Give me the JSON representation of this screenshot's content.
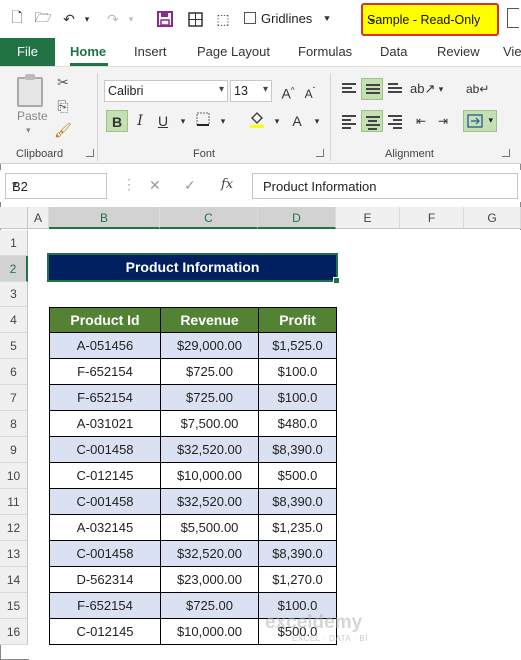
{
  "title_bar": {
    "workbook_label": "Sample  -  Read-Only",
    "gridlines_label": "Gridlines"
  },
  "ribbon_tabs": [
    "File",
    "Home",
    "Insert",
    "Page Layout",
    "Formulas",
    "Data",
    "Review",
    "Vie"
  ],
  "ribbon": {
    "clipboard": {
      "paste_label": "Paste",
      "group_label": "Clipboard"
    },
    "font": {
      "font_name": "Calibri",
      "font_size": "13",
      "group_label": "Font",
      "bold": "B",
      "italic": "I",
      "underline": "U"
    },
    "alignment": {
      "group_label": "Alignment"
    }
  },
  "formula_bar": {
    "name_box": "B2",
    "cancel": "✕",
    "enter": "✓",
    "fx": "fx",
    "content": "Product Information"
  },
  "columns": [
    "A",
    "B",
    "C",
    "D",
    "E",
    "F",
    "G"
  ],
  "rows": [
    "1",
    "2",
    "3",
    "4",
    "5",
    "6",
    "7",
    "8",
    "9",
    "10",
    "11",
    "12",
    "13",
    "14",
    "15",
    "16"
  ],
  "sheet": {
    "title": "Product Information",
    "headers": [
      "Product Id",
      "Revenue",
      "Profit"
    ],
    "data": [
      [
        "A-051456",
        "$29,000.00",
        "$1,525.0"
      ],
      [
        "F-652154",
        "$725.00",
        "$100.0"
      ],
      [
        "F-652154",
        "$725.00",
        "$100.0"
      ],
      [
        "A-031021",
        "$7,500.00",
        "$480.0"
      ],
      [
        "C-001458",
        "$32,520.00",
        "$8,390.0"
      ],
      [
        "C-012145",
        "$10,000.00",
        "$500.0"
      ],
      [
        "C-001458",
        "$32,520.00",
        "$8,390.0"
      ],
      [
        "A-032145",
        "$5,500.00",
        "$1,235.0"
      ],
      [
        "C-001458",
        "$32,520.00",
        "$8,390.0"
      ],
      [
        "D-562314",
        "$23,000.00",
        "$1,270.0"
      ],
      [
        "F-652154",
        "$725.00",
        "$100.0"
      ],
      [
        "C-012145",
        "$10,000.00",
        "$500.0"
      ]
    ]
  },
  "watermark": {
    "name": "exceldemy",
    "tagline": "EXCEL · DATA · BI"
  },
  "colors": {
    "excel_green": "#217346",
    "title_fill": "#002060",
    "header_fill": "#548235",
    "band_fill": "#d9e1f2",
    "highlight": "#ffff00"
  }
}
